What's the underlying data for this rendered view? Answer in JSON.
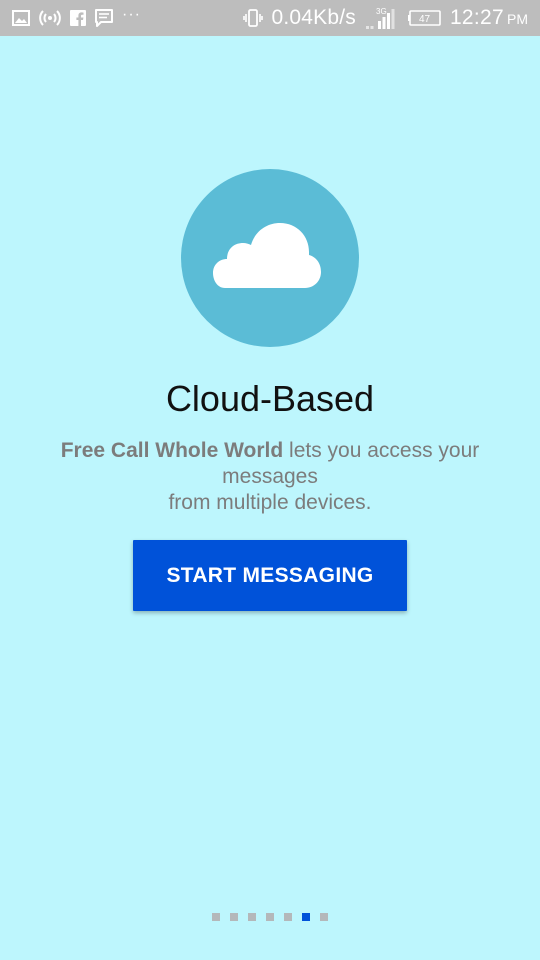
{
  "status_bar": {
    "left_icons": [
      "gallery-icon",
      "hotspot-icon",
      "facebook-icon",
      "message-icon"
    ],
    "more_notifications": "···",
    "vibrate_icon": "vibrate-icon",
    "network_speed": "0.04Kb/s",
    "network_type": "3G",
    "battery_level": "47",
    "time": "12:27",
    "ampm": "PM"
  },
  "onboarding": {
    "icon": "cloud-icon",
    "title": "Cloud-Based",
    "description_app_name": "Free Call Whole World",
    "description_rest_line1": " lets you access your messages",
    "description_line2": "from multiple devices.",
    "button_label": "START MESSAGING"
  },
  "pager": {
    "count": 7,
    "active_index": 5
  },
  "colors": {
    "background": "#bdf6fd",
    "status_bar": "#bdbdbd",
    "circle": "#5bbcd6",
    "button": "#0052d9",
    "dot_inactive": "#b4b8ba",
    "dot_active": "#0052d9"
  }
}
